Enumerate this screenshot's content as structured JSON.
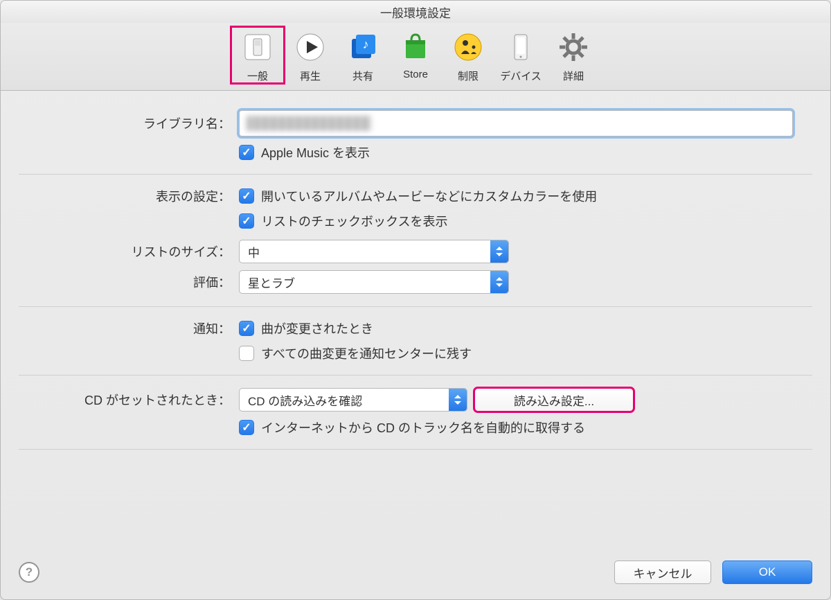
{
  "window_title": "一般環境設定",
  "toolbar": [
    {
      "label": "一般"
    },
    {
      "label": "再生"
    },
    {
      "label": "共有"
    },
    {
      "label": "Store"
    },
    {
      "label": "制限"
    },
    {
      "label": "デバイス"
    },
    {
      "label": "詳細"
    }
  ],
  "library": {
    "label": "ライブラリ名：",
    "apple_music": "Apple Music を表示"
  },
  "display": {
    "label": "表示の設定：",
    "custom_color": "開いているアルバムやムービーなどにカスタムカラーを使用",
    "list_checkbox": "リストのチェックボックスを表示"
  },
  "list_size": {
    "label": "リストのサイズ：",
    "value": "中"
  },
  "rating": {
    "label": "評価：",
    "value": "星とラブ"
  },
  "notify": {
    "label": "通知：",
    "song_changed": "曲が変更されたとき",
    "keep_all": "すべての曲変更を通知センターに残す"
  },
  "cd": {
    "label": "CD がセットされたとき：",
    "value": "CD の読み込みを確認",
    "import_btn": "読み込み設定...",
    "auto_fetch": "インターネットから CD のトラック名を自動的に取得する"
  },
  "footer": {
    "cancel": "キャンセル",
    "ok": "OK"
  }
}
